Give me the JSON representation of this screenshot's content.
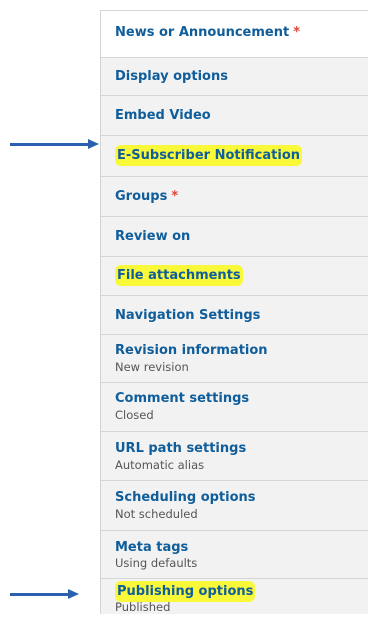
{
  "tabs": [
    {
      "label": "News or Announcement",
      "required": true,
      "summary": "",
      "active": true,
      "highlighted": false
    },
    {
      "label": "Display options",
      "required": false,
      "summary": "",
      "highlighted": false
    },
    {
      "label": "Embed Video",
      "required": false,
      "summary": "",
      "highlighted": false
    },
    {
      "label": "E-Subscriber Notification",
      "required": false,
      "summary": "",
      "highlighted": true
    },
    {
      "label": "Groups",
      "required": true,
      "summary": "",
      "highlighted": false
    },
    {
      "label": "Review on",
      "required": false,
      "summary": "",
      "highlighted": false
    },
    {
      "label": "File attachments",
      "required": false,
      "summary": "",
      "highlighted": true
    },
    {
      "label": "Navigation Settings",
      "required": false,
      "summary": "",
      "highlighted": false
    },
    {
      "label": "Revision information",
      "required": false,
      "summary": "New revision",
      "highlighted": false
    },
    {
      "label": "Comment settings",
      "required": false,
      "summary": "Closed",
      "highlighted": false
    },
    {
      "label": "URL path settings",
      "required": false,
      "summary": "Automatic alias",
      "highlighted": false
    },
    {
      "label": "Scheduling options",
      "required": false,
      "summary": "Not scheduled",
      "highlighted": false
    },
    {
      "label": "Meta tags",
      "required": false,
      "summary": "Using defaults",
      "highlighted": false
    },
    {
      "label": "Publishing options",
      "required": false,
      "summary": "Published",
      "highlighted": true
    }
  ],
  "required_marker": "*",
  "colors": {
    "link": "#0f5d9a",
    "required": "#e0453a",
    "highlight": "#f9f93a",
    "arrow": "#2b5fb0"
  }
}
